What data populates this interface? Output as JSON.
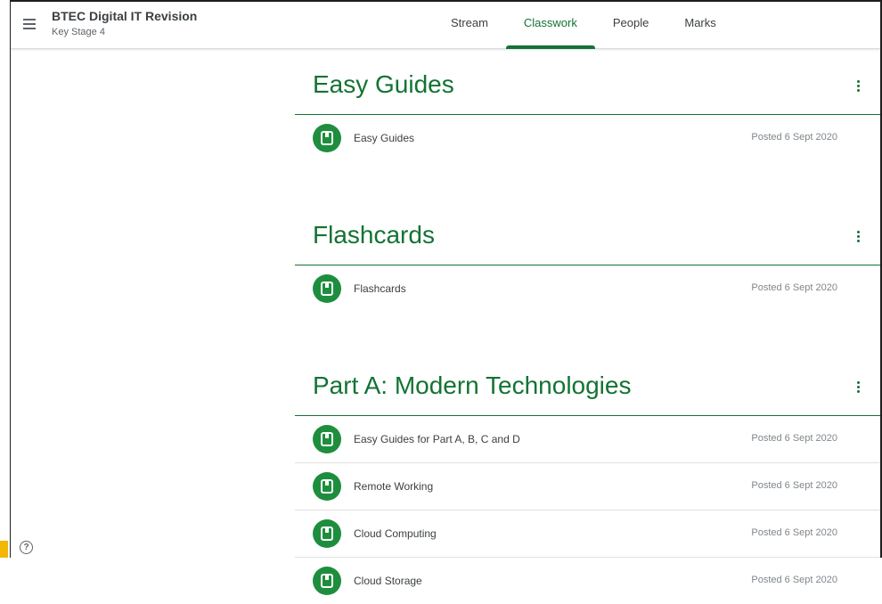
{
  "header": {
    "class_title": "BTEC Digital IT Revision",
    "class_subtitle": "Key Stage 4",
    "tabs": [
      {
        "label": "Stream"
      },
      {
        "label": "Classwork"
      },
      {
        "label": "People"
      },
      {
        "label": "Marks"
      }
    ],
    "active_tab": "Classwork"
  },
  "help_icon_glyph": "?",
  "colors": {
    "accent": "#137333",
    "icon_bg": "#1e8e3e"
  },
  "topics": [
    {
      "title": "Easy Guides",
      "items": [
        {
          "title": "Easy Guides",
          "date": "Posted 6 Sept 2020"
        }
      ]
    },
    {
      "title": "Flashcards",
      "items": [
        {
          "title": "Flashcards",
          "date": "Posted 6 Sept 2020"
        }
      ]
    },
    {
      "title": "Part A: Modern Technologies",
      "items": [
        {
          "title": "Easy Guides for Part A, B, C and D",
          "date": "Posted 6 Sept 2020"
        },
        {
          "title": "Remote Working",
          "date": "Posted 6 Sept 2020"
        },
        {
          "title": "Cloud Computing",
          "date": "Posted 6 Sept 2020"
        },
        {
          "title": "Cloud Storage",
          "date": "Posted 6 Sept 2020"
        }
      ]
    }
  ]
}
